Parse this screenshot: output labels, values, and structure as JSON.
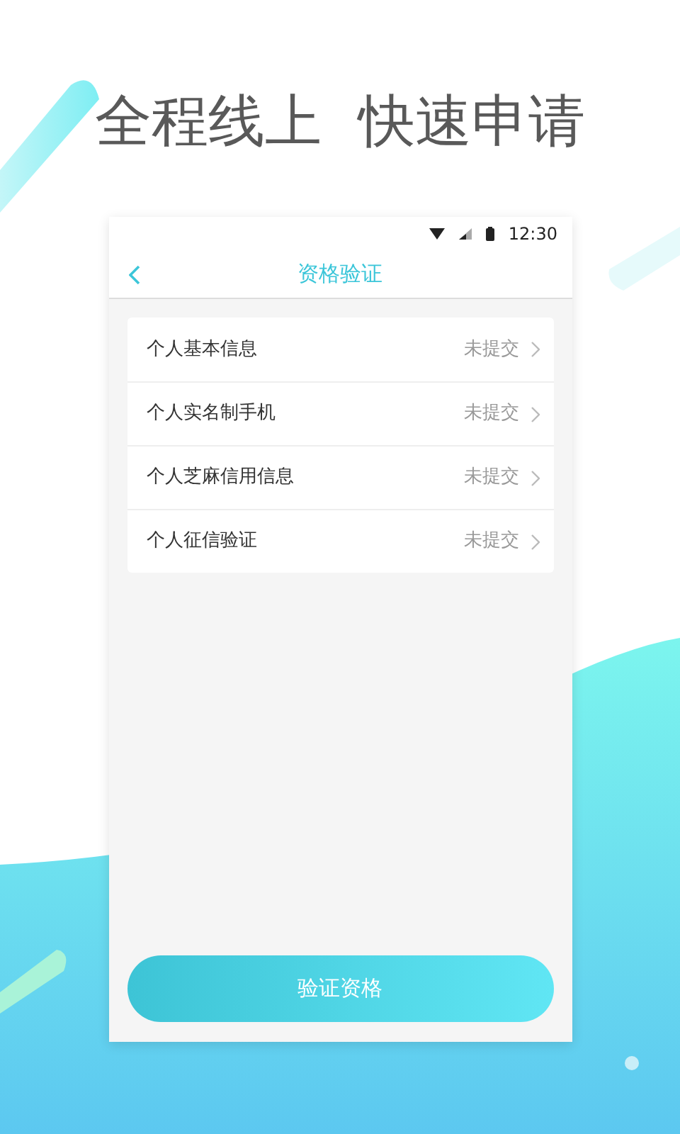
{
  "headline": [
    "全程线上",
    "快速申请"
  ],
  "status_bar": {
    "time": "12:30"
  },
  "header": {
    "title": "资格验证"
  },
  "items": [
    {
      "label": "个人基本信息",
      "status": "未提交"
    },
    {
      "label": "个人实名制手机",
      "status": "未提交"
    },
    {
      "label": "个人芝麻信用信息",
      "status": "未提交"
    },
    {
      "label": "个人征信验证",
      "status": "未提交"
    }
  ],
  "button": "验证资格"
}
